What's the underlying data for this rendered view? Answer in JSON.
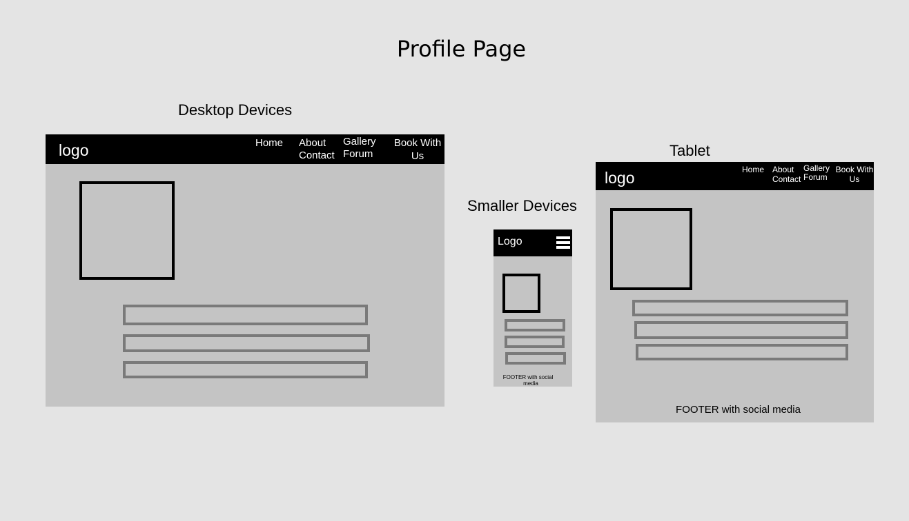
{
  "page_title": "Profile Page",
  "desktop": {
    "heading": "Desktop Devices",
    "logo": "logo",
    "nav": {
      "home": "Home",
      "about": "About",
      "contact": "Contact",
      "gallery": "Gallery",
      "forum": "Forum",
      "book_line1": "Book With",
      "book_line2": "Us"
    }
  },
  "smaller": {
    "heading": "Smaller Devices",
    "logo": "Logo",
    "footer_line1": "FOOTER with social",
    "footer_line2": "media"
  },
  "tablet": {
    "heading": "Tablet",
    "logo": "logo",
    "nav": {
      "home": "Home",
      "about": "About",
      "contact": "Contact",
      "gallery": "Gallery",
      "forum": "Forum",
      "book_line1": "Book With",
      "book_line2": "Us"
    },
    "footer": "FOOTER with social media"
  },
  "colors": {
    "background": "#e4e4e4",
    "frame": "#c4c4c4",
    "navbar": "#000000",
    "bar_border": "#7a7a7a"
  }
}
